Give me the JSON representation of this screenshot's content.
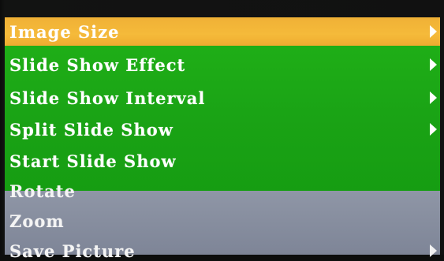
{
  "menu": {
    "items": [
      {
        "label": "Image Size",
        "has_submenu": true,
        "state": "selected"
      },
      {
        "label": "Slide Show Effect",
        "has_submenu": true,
        "state": "enabled"
      },
      {
        "label": "Slide Show Interval",
        "has_submenu": true,
        "state": "enabled"
      },
      {
        "label": "Split Slide Show",
        "has_submenu": true,
        "state": "enabled"
      },
      {
        "label": "Start Slide Show",
        "has_submenu": false,
        "state": "enabled"
      },
      {
        "label": "Rotate",
        "has_submenu": false,
        "state": "disabled"
      },
      {
        "label": "Zoom",
        "has_submenu": false,
        "state": "disabled"
      },
      {
        "label": "Save Picture",
        "has_submenu": true,
        "state": "disabled"
      }
    ]
  },
  "colors": {
    "selected": "#f3b436",
    "enabled": "#1ca716",
    "disabled": "#878ea0",
    "text": "#ffffff"
  },
  "icons": {
    "submenu_arrow": "triangle-right-icon"
  }
}
